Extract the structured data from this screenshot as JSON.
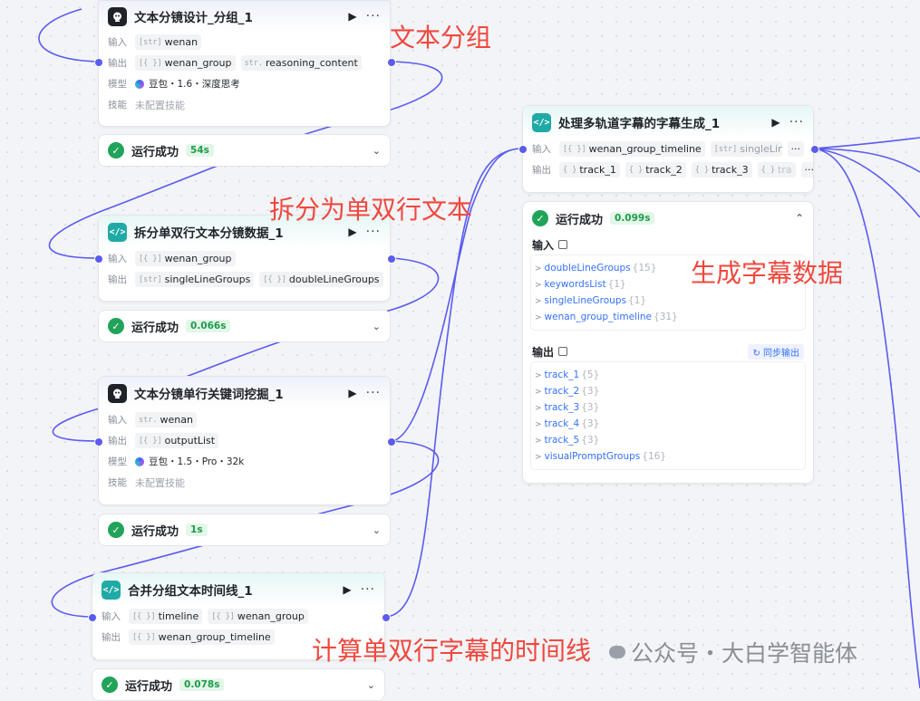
{
  "nodes": {
    "n1": {
      "title": "文本分镜设计_分组_1",
      "input_label": "输入",
      "input_1": {
        "type": "[str]",
        "name": "wenan"
      },
      "output_label": "输出",
      "output_1": {
        "type": "[{ }]",
        "name": "wenan_group"
      },
      "output_2": {
        "type": "str.",
        "name": "reasoning_content"
      },
      "model_label": "模型",
      "model": "豆包・1.6・深度思考",
      "skill_label": "技能",
      "skill": "未配置技能",
      "status": "运行成功",
      "duration": "54s"
    },
    "n2": {
      "title": "拆分单双行文本分镜数据_1",
      "input_label": "输入",
      "input_1": {
        "type": "[{ }]",
        "name": "wenan_group"
      },
      "output_label": "输出",
      "output_1": {
        "type": "[str]",
        "name": "singleLineGroups"
      },
      "output_2": {
        "type": "[{ }]",
        "name": "doubleLineGroups"
      },
      "status": "运行成功",
      "duration": "0.066s"
    },
    "n3": {
      "title": "文本分镜单行关键词挖掘_1",
      "input_label": "输入",
      "input_1": {
        "type": "str.",
        "name": "wenan"
      },
      "output_label": "输出",
      "output_1": {
        "type": "[{ }]",
        "name": "outputList"
      },
      "model_label": "模型",
      "model": "豆包・1.5・Pro・32k",
      "skill_label": "技能",
      "skill": "未配置技能",
      "status": "运行成功",
      "duration": "1s"
    },
    "n4": {
      "title": "合并分组文本时间线_1",
      "input_label": "输入",
      "input_1": {
        "type": "[{ }]",
        "name": "timeline"
      },
      "input_2": {
        "type": "[{ }]",
        "name": "wenan_group"
      },
      "output_label": "输出",
      "output_1": {
        "type": "[{ }]",
        "name": "wenan_group_timeline"
      },
      "status": "运行成功",
      "duration": "0.078s"
    },
    "n5": {
      "title": "处理多轨道字幕的字幕生成_1",
      "input_label": "输入",
      "input_1": {
        "type": "[{ }]",
        "name": "wenan_group_timeline"
      },
      "input_2": {
        "type": "[str]",
        "name": "singleLineGr"
      },
      "input_more": "···",
      "output_label": "输出",
      "output_1": {
        "type": "{ }",
        "name": "track_1"
      },
      "output_2": {
        "type": "{ }",
        "name": "track_2"
      },
      "output_3": {
        "type": "{ }",
        "name": "track_3"
      },
      "output_4": {
        "type": "{ }",
        "name": "tra"
      },
      "output_more": "···",
      "status": "运行成功",
      "duration": "0.099s",
      "input_section": "输入",
      "inputs": [
        {
          "name": "doubleLineGroups",
          "count": "{15}"
        },
        {
          "name": "keywordsList",
          "count": "{1}"
        },
        {
          "name": "singleLineGroups",
          "count": "{1}"
        },
        {
          "name": "wenan_group_timeline",
          "count": "{31}"
        }
      ],
      "output_section": "输出",
      "sync_label": "同步输出",
      "outputs": [
        {
          "name": "track_1",
          "count": "{5}"
        },
        {
          "name": "track_2",
          "count": "{3}"
        },
        {
          "name": "track_3",
          "count": "{3}"
        },
        {
          "name": "track_4",
          "count": "{3}"
        },
        {
          "name": "track_5",
          "count": "{3}"
        },
        {
          "name": "visualPromptGroups",
          "count": "{16}"
        }
      ]
    }
  },
  "annotations": {
    "a1": "文本分组",
    "a2": "拆分为单双行文本",
    "a3": "生成字幕数据",
    "a4": "计算单双行字幕的时间线"
  },
  "watermark": "公众号・大白学智能体",
  "icons": {
    "play": "play-icon",
    "more": "more-icon",
    "check": "check-icon",
    "chevron": "chevron-icon"
  },
  "colors": {
    "port": "#5b5bf0",
    "success": "#22a35a",
    "annotation": "#f0483e",
    "link": "#3370ff"
  }
}
